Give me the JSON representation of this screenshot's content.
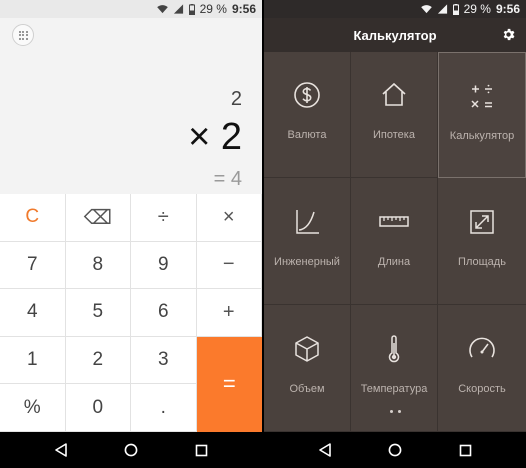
{
  "status": {
    "battery": "29 %",
    "time": "9:56"
  },
  "calculator": {
    "display": {
      "previous": "2",
      "expression": "× 2",
      "result": "= 4"
    },
    "keys": [
      {
        "label": "C",
        "name": "clear-key",
        "style": "orange-text"
      },
      {
        "label": "⌫",
        "name": "backspace-key",
        "style": "op"
      },
      {
        "label": "÷",
        "name": "divide-key",
        "style": "op"
      },
      {
        "label": "×",
        "name": "multiply-key",
        "style": "op"
      },
      {
        "label": "7",
        "name": "digit-7-key",
        "style": ""
      },
      {
        "label": "8",
        "name": "digit-8-key",
        "style": ""
      },
      {
        "label": "9",
        "name": "digit-9-key",
        "style": ""
      },
      {
        "label": "−",
        "name": "minus-key",
        "style": "op"
      },
      {
        "label": "4",
        "name": "digit-4-key",
        "style": ""
      },
      {
        "label": "5",
        "name": "digit-5-key",
        "style": ""
      },
      {
        "label": "6",
        "name": "digit-6-key",
        "style": ""
      },
      {
        "label": "+",
        "name": "plus-key",
        "style": "op"
      },
      {
        "label": "1",
        "name": "digit-1-key",
        "style": ""
      },
      {
        "label": "2",
        "name": "digit-2-key",
        "style": ""
      },
      {
        "label": "3",
        "name": "digit-3-key",
        "style": ""
      },
      {
        "label": "=",
        "name": "equals-key",
        "style": "equals"
      },
      {
        "label": "%",
        "name": "percent-key",
        "style": ""
      },
      {
        "label": "0",
        "name": "digit-0-key",
        "style": ""
      },
      {
        "label": ".",
        "name": "decimal-key",
        "style": ""
      }
    ]
  },
  "menu": {
    "title": "Калькулятор",
    "items": [
      {
        "label": "Валюта",
        "icon": "currency-icon"
      },
      {
        "label": "Ипотека",
        "icon": "house-icon"
      },
      {
        "label": "Калькулятор",
        "icon": "calculator-ops-icon",
        "active": true
      },
      {
        "label": "Инженерный",
        "icon": "function-curve-icon"
      },
      {
        "label": "Длина",
        "icon": "ruler-icon"
      },
      {
        "label": "Площадь",
        "icon": "expand-square-icon"
      },
      {
        "label": "Объем",
        "icon": "cube-icon"
      },
      {
        "label": "Температура",
        "icon": "thermometer-icon"
      },
      {
        "label": "Скорость",
        "icon": "speedometer-icon"
      }
    ]
  },
  "colors": {
    "accent_orange": "#fb7a2c",
    "menu_bg": "#4a413d",
    "menu_header": "#342e2c"
  }
}
